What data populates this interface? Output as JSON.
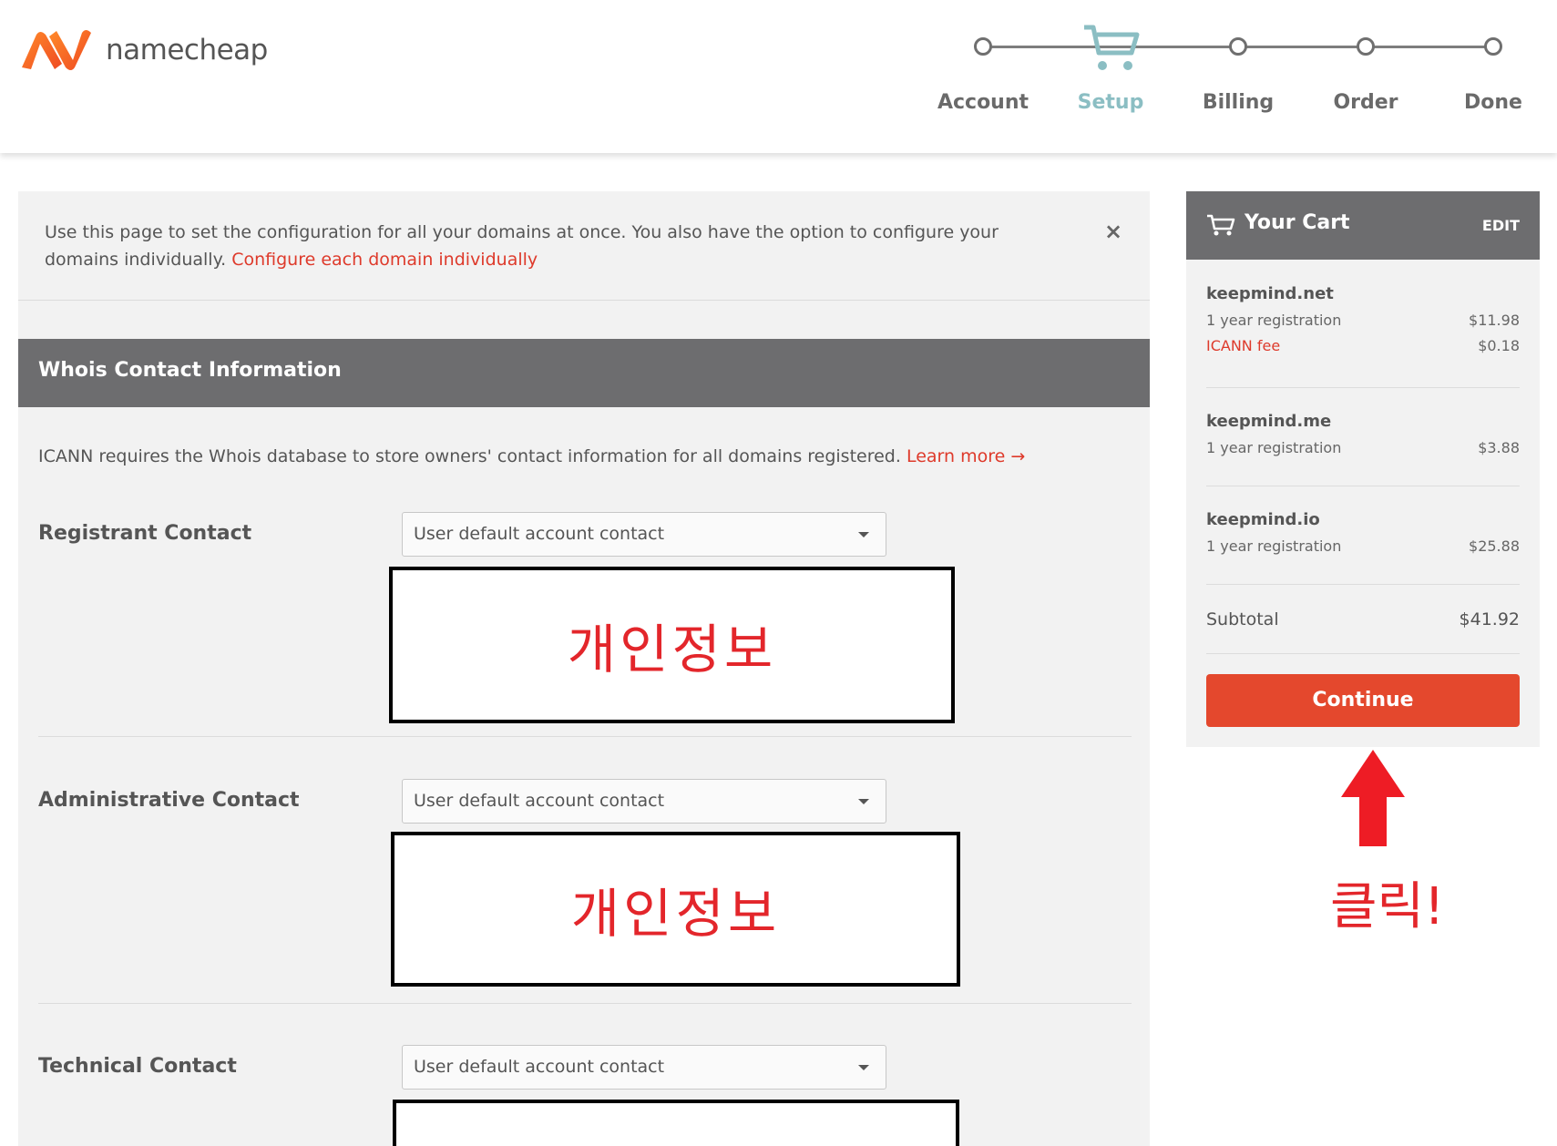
{
  "brand": {
    "name": "namecheap"
  },
  "steps": [
    {
      "label": "Account",
      "active": false
    },
    {
      "label": "Setup",
      "active": true
    },
    {
      "label": "Billing",
      "active": false
    },
    {
      "label": "Order",
      "active": false
    },
    {
      "label": "Done",
      "active": false
    }
  ],
  "notice": {
    "text": "Use this page to set the configuration for all your domains at once. You also have the option to configure your domains individually.",
    "link": "Configure each domain individually",
    "close": "×"
  },
  "whois": {
    "title": "Whois Contact Information",
    "intro": "ICANN requires the Whois database to store owners' contact information for all domains registered.",
    "learn_more": "Learn more →",
    "contacts": [
      {
        "label": "Registrant Contact",
        "value": "User default account contact",
        "redacted": "개인정보"
      },
      {
        "label": "Administrative Contact",
        "value": "User default account contact",
        "redacted": "개인정보"
      },
      {
        "label": "Technical Contact",
        "value": "User default account contact",
        "redacted": ""
      }
    ]
  },
  "cart": {
    "title": "Your Cart",
    "edit": "EDIT",
    "items": [
      {
        "name": "keepmind.net",
        "desc": "1 year registration",
        "price": "$11.98",
        "fee_label": "ICANN fee",
        "fee_price": "$0.18"
      },
      {
        "name": "keepmind.me",
        "desc": "1 year registration",
        "price": "$3.88"
      },
      {
        "name": "keepmind.io",
        "desc": "1 year registration",
        "price": "$25.88"
      }
    ],
    "subtotal_label": "Subtotal",
    "subtotal_value": "$41.92",
    "continue": "Continue"
  },
  "annotation": {
    "text": "클릭!"
  },
  "colors": {
    "accent": "#e4482d",
    "header_bar": "#6d6d6f",
    "step_active": "#8bbec3",
    "annotation": "#e3262b"
  }
}
